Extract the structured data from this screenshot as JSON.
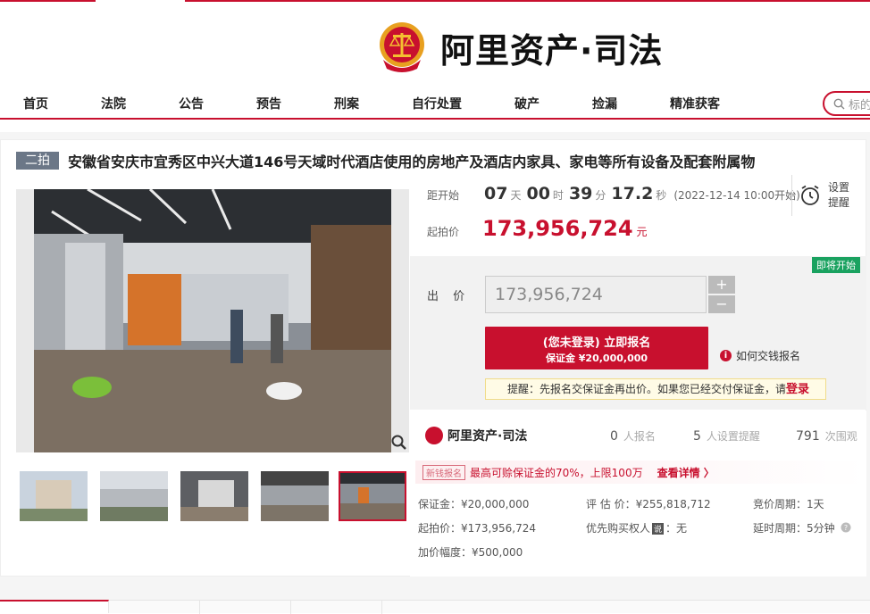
{
  "brand": {
    "title": "阿里资产·司法",
    "small_title": "阿里资产·司法"
  },
  "nav": {
    "items": [
      {
        "label": "首页"
      },
      {
        "label": "法院"
      },
      {
        "label": "公告"
      },
      {
        "label": "预告"
      },
      {
        "label": "刑案"
      },
      {
        "label": "自行处置"
      },
      {
        "label": "破产"
      },
      {
        "label": "捡漏"
      },
      {
        "label": "精准获客"
      }
    ],
    "search_placeholder": "标的"
  },
  "auction": {
    "round_badge": "二拍",
    "title": "安徽省安庆市宜秀区中兴大道146号天域时代酒店使用的房地产及酒店内家具、家电等所有设备及配套附属物",
    "countdown": {
      "label": "距开始",
      "days": "07",
      "days_unit": "天",
      "hours": "00",
      "hours_unit": "时",
      "minutes": "39",
      "minutes_unit": "分",
      "seconds": "17.2",
      "seconds_unit": "秒",
      "start_note": "(2022-12-14 10:00开始)"
    },
    "remind": {
      "line1": "设置",
      "line2": "提醒"
    },
    "start_price": {
      "label": "起拍价",
      "value": "173,956,724",
      "unit": "元"
    },
    "status_badge": "即将开始",
    "bid": {
      "label": "出 价",
      "value": "173,956,724",
      "plus": "+",
      "minus": "−"
    },
    "register_button": {
      "main": "(您未登录) 立即报名",
      "sub": "保证金 ¥20,000,000"
    },
    "howto": {
      "icon": "i",
      "label": "如何交钱报名"
    },
    "tip": {
      "text": "提醒：先报名交保证金再出价。如果您已经交付保证金，请",
      "link": "登录"
    }
  },
  "stats": [
    {
      "num": "0",
      "unit": "人报名"
    },
    {
      "num": "5",
      "unit": "人设置提醒"
    },
    {
      "num": "791",
      "unit": "次围观"
    }
  ],
  "promo": {
    "tag": "新钱报名",
    "text": "最高可赊保证金的70%，上限100万",
    "more": "查看详情 〉"
  },
  "details": {
    "deposit": "保证金：¥20,000,000",
    "appraisal": "评 估 价：¥255,818,712",
    "cycle": "竞价周期：1天",
    "start": "起拍价：¥173,956,724",
    "priority": "优先购买权人",
    "priority_value": "：无",
    "priority_badge": "说",
    "delay": "延时周期：5分钟",
    "increment": "加价幅度：¥500,000"
  },
  "colors": {
    "accent": "#c8102e",
    "green": "#1aa260"
  }
}
